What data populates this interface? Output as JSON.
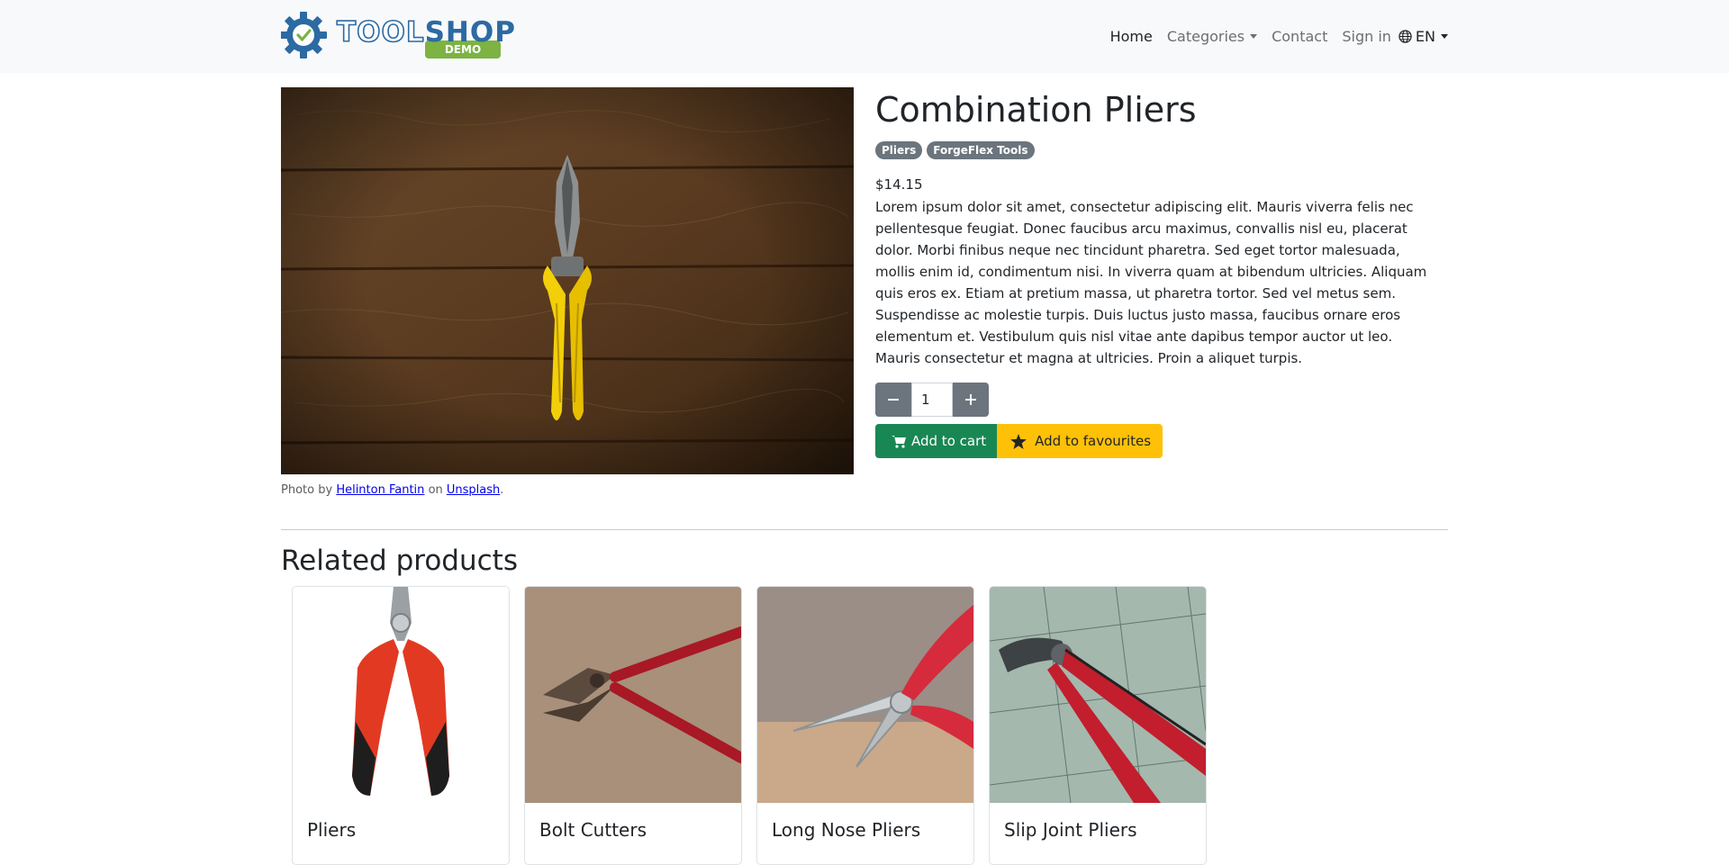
{
  "brand": {
    "name_part1": "TOOL",
    "name_part2": "SHOP",
    "tag": "DEMO"
  },
  "nav": {
    "home": "Home",
    "categories": "Categories",
    "contact": "Contact",
    "signin": "Sign in",
    "language": "EN"
  },
  "product": {
    "title": "Combination Pliers",
    "badges": [
      "Pliers",
      "ForgeFlex Tools"
    ],
    "price": "$14.15",
    "description": "Lorem ipsum dolor sit amet, consectetur adipiscing elit. Mauris viverra felis nec pellentesque feugiat. Donec faucibus arcu maximus, convallis nisl eu, placerat dolor. Morbi finibus neque nec tincidunt pharetra. Sed eget tortor malesuada, mollis enim id, condimentum nisi. In viverra quam at bibendum ultricies. Aliquam quis eros ex. Etiam at pretium massa, ut pharetra tortor. Sed vel metus sem. Suspendisse ac molestie turpis. Duis luctus justo massa, faucibus ornare eros elementum et. Vestibulum quis nisl vitae ante dapibus tempor auctor ut leo. Mauris consectetur et magna at ultricies. Proin a aliquet turpis.",
    "quantity": "1",
    "add_to_cart": "Add to cart",
    "add_to_favourites": "Add to favourites",
    "credit": {
      "prefix": "Photo by",
      "author": "Helinton Fantin",
      "middle": "on",
      "source": "Unsplash",
      "suffix": "."
    }
  },
  "related": {
    "title": "Related products",
    "items": [
      {
        "name": "Pliers"
      },
      {
        "name": "Bolt Cutters"
      },
      {
        "name": "Long Nose Pliers"
      },
      {
        "name": "Slip Joint Pliers"
      }
    ]
  },
  "colors": {
    "navbar_bg": "#f8f9fa",
    "brand_blue": "#2c6aa3",
    "brand_green": "#7cb342",
    "secondary": "#6c757d",
    "success": "#198754",
    "warning": "#ffc107"
  },
  "icons": [
    "gear-check-logo-icon",
    "globe-icon",
    "chevron-down-icon",
    "minus-icon",
    "plus-icon",
    "cart-icon",
    "star-icon"
  ]
}
